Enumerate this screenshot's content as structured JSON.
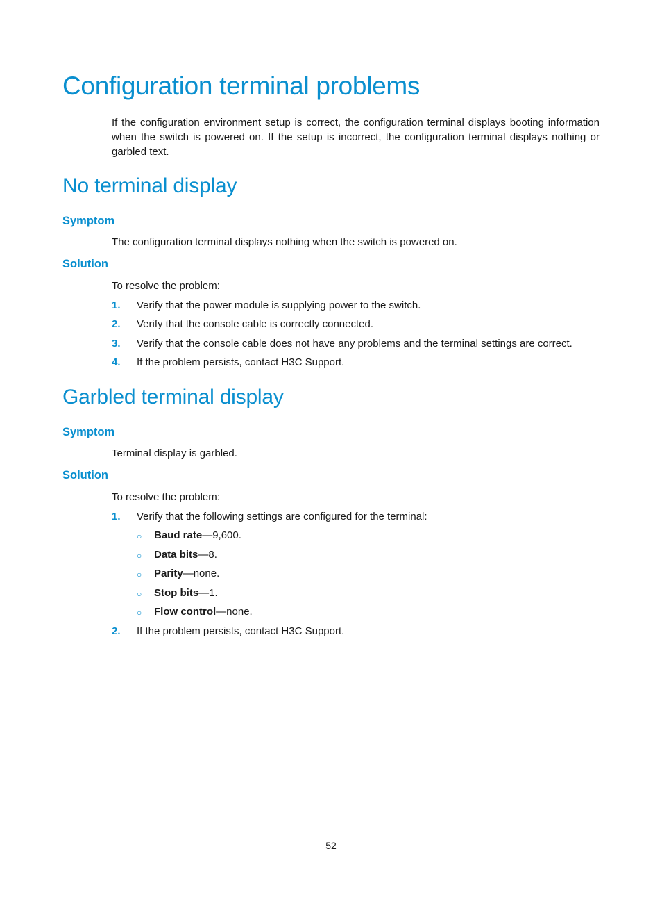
{
  "title": "Configuration terminal problems",
  "intro": "If the configuration environment setup is correct, the configuration terminal displays booting information when the switch is powered on. If the setup is incorrect, the configuration terminal displays nothing or garbled text.",
  "sections": [
    {
      "heading": "No terminal display",
      "symptom_heading": "Symptom",
      "symptom_text": "The configuration terminal displays nothing when the switch is powered on.",
      "solution_heading": "Solution",
      "solution_intro": "To resolve the problem:",
      "steps": [
        {
          "num": "1.",
          "text": "Verify that the power module is supplying power to the switch."
        },
        {
          "num": "2.",
          "text": "Verify that the console cable is correctly connected."
        },
        {
          "num": "3.",
          "text": "Verify that the console cable does not have any problems and the terminal settings are correct."
        },
        {
          "num": "4.",
          "text": "If the problem persists, contact H3C Support."
        }
      ]
    },
    {
      "heading": "Garbled terminal display",
      "symptom_heading": "Symptom",
      "symptom_text": "Terminal display is garbled.",
      "solution_heading": "Solution",
      "solution_intro": "To resolve the problem:",
      "steps": [
        {
          "num": "1.",
          "text": "Verify that the following settings are configured for the terminal:"
        },
        {
          "num": "2.",
          "text": "If the problem persists, contact H3C Support."
        }
      ],
      "settings": [
        {
          "name": "Baud rate",
          "value": "—9,600."
        },
        {
          "name": "Data bits",
          "value": "—8."
        },
        {
          "name": "Parity",
          "value": "—none."
        },
        {
          "name": "Stop bits",
          "value": "—1."
        },
        {
          "name": "Flow control",
          "value": "—none."
        }
      ]
    }
  ],
  "bullet_glyph": "○",
  "page_number": "52"
}
